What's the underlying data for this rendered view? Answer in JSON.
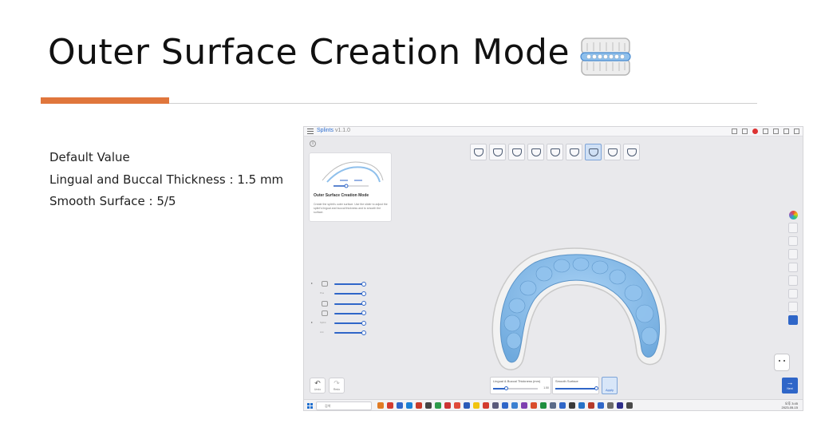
{
  "slide": {
    "title": "Outer Surface Creation Mode",
    "notes": [
      "Default Value",
      "Lingual and Buccal Thickness : 1.5 mm",
      "Smooth Surface : 5/5"
    ],
    "accent_color": "#E0763C",
    "title_icon": "dental-splint-icon"
  },
  "app": {
    "name": "Splints",
    "version": "v1.1.0",
    "help_card": {
      "title": "Outer Surface Creation Mode",
      "description": "Create the splint's outer surface. Use the slider to adjust the splint's lingual and buccal thickness and to smooth the surface."
    },
    "toolbar_tools": [
      "settings-icon",
      "align-icon",
      "path-icon",
      "block-out-icon",
      "arch-icon",
      "occlusion-icon",
      "outer-surface-icon",
      "text-icon",
      "check-icon"
    ],
    "active_tool_index": 6,
    "left_sliders": [
      {
        "icon": "jaw-icon",
        "label": "",
        "mark": "▸",
        "level": 1.0
      },
      {
        "icon": "",
        "label": "Pos",
        "mark": "",
        "level": 1.0
      },
      {
        "icon": "upper-arch-icon",
        "label": "",
        "mark": "",
        "level": 1.0
      },
      {
        "icon": "lower-arch-icon",
        "label": "",
        "mark": "",
        "level": 1.0
      },
      {
        "icon": "",
        "label": "Splint",
        "mark": "▸",
        "level": 1.0
      },
      {
        "icon": "",
        "label": "Ant",
        "mark": "",
        "level": 1.0
      }
    ],
    "right_tools": [
      "color-wheel-icon",
      "grid-icon",
      "view-icon",
      "hand-icon",
      "scan-icon",
      "layer-icon",
      "box-icon",
      "rotate-icon",
      "screen-icon"
    ],
    "undo": {
      "glyph": "↶",
      "label": "Undo"
    },
    "redo": {
      "glyph": "↷",
      "label": "Redo"
    },
    "thickness_panel": {
      "label": "Lingual & Buccal Thickness (mm)",
      "value": "1.50",
      "level": 0.3
    },
    "smooth_panel": {
      "label": "Smooth Surface",
      "level": 1.0
    },
    "apply_label": "Apply",
    "next": {
      "glyph": "→",
      "label": "Next"
    },
    "taskbar": {
      "search_placeholder": "검색",
      "app_colors": [
        "#e07b24",
        "#d33b2f",
        "#2f66c8",
        "#1a7fd4",
        "#c73a2a",
        "#444444",
        "#2d9a4a",
        "#cc3333",
        "#e04a3a",
        "#2b5bb8",
        "#f1c40f",
        "#d33b2f",
        "#5a5a7a",
        "#2f66c8",
        "#3b7fd0",
        "#7d3fb0",
        "#d94b2b",
        "#1e8e3e",
        "#5a6a88",
        "#2f66c8",
        "#3a3a3a",
        "#2673c8",
        "#b53a2a",
        "#2f66c8",
        "#6a6a6a",
        "#2d2d8a",
        "#4a4a4a"
      ],
      "time": "오후 3:45",
      "date": "2023-05-15"
    }
  }
}
